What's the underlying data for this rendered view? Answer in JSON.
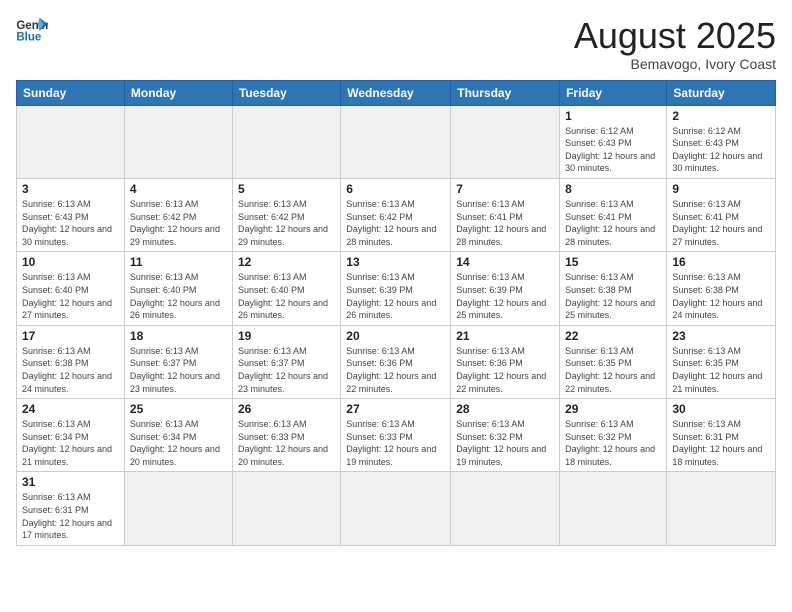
{
  "header": {
    "logo_general": "General",
    "logo_blue": "Blue",
    "month_title": "August 2025",
    "location": "Bemavogo, Ivory Coast"
  },
  "weekdays": [
    "Sunday",
    "Monday",
    "Tuesday",
    "Wednesday",
    "Thursday",
    "Friday",
    "Saturday"
  ],
  "weeks": [
    [
      {
        "day": "",
        "info": ""
      },
      {
        "day": "",
        "info": ""
      },
      {
        "day": "",
        "info": ""
      },
      {
        "day": "",
        "info": ""
      },
      {
        "day": "",
        "info": ""
      },
      {
        "day": "1",
        "info": "Sunrise: 6:12 AM\nSunset: 6:43 PM\nDaylight: 12 hours and 30 minutes."
      },
      {
        "day": "2",
        "info": "Sunrise: 6:12 AM\nSunset: 6:43 PM\nDaylight: 12 hours and 30 minutes."
      }
    ],
    [
      {
        "day": "3",
        "info": "Sunrise: 6:13 AM\nSunset: 6:43 PM\nDaylight: 12 hours and 30 minutes."
      },
      {
        "day": "4",
        "info": "Sunrise: 6:13 AM\nSunset: 6:42 PM\nDaylight: 12 hours and 29 minutes."
      },
      {
        "day": "5",
        "info": "Sunrise: 6:13 AM\nSunset: 6:42 PM\nDaylight: 12 hours and 29 minutes."
      },
      {
        "day": "6",
        "info": "Sunrise: 6:13 AM\nSunset: 6:42 PM\nDaylight: 12 hours and 28 minutes."
      },
      {
        "day": "7",
        "info": "Sunrise: 6:13 AM\nSunset: 6:41 PM\nDaylight: 12 hours and 28 minutes."
      },
      {
        "day": "8",
        "info": "Sunrise: 6:13 AM\nSunset: 6:41 PM\nDaylight: 12 hours and 28 minutes."
      },
      {
        "day": "9",
        "info": "Sunrise: 6:13 AM\nSunset: 6:41 PM\nDaylight: 12 hours and 27 minutes."
      }
    ],
    [
      {
        "day": "10",
        "info": "Sunrise: 6:13 AM\nSunset: 6:40 PM\nDaylight: 12 hours and 27 minutes."
      },
      {
        "day": "11",
        "info": "Sunrise: 6:13 AM\nSunset: 6:40 PM\nDaylight: 12 hours and 26 minutes."
      },
      {
        "day": "12",
        "info": "Sunrise: 6:13 AM\nSunset: 6:40 PM\nDaylight: 12 hours and 26 minutes."
      },
      {
        "day": "13",
        "info": "Sunrise: 6:13 AM\nSunset: 6:39 PM\nDaylight: 12 hours and 26 minutes."
      },
      {
        "day": "14",
        "info": "Sunrise: 6:13 AM\nSunset: 6:39 PM\nDaylight: 12 hours and 25 minutes."
      },
      {
        "day": "15",
        "info": "Sunrise: 6:13 AM\nSunset: 6:38 PM\nDaylight: 12 hours and 25 minutes."
      },
      {
        "day": "16",
        "info": "Sunrise: 6:13 AM\nSunset: 6:38 PM\nDaylight: 12 hours and 24 minutes."
      }
    ],
    [
      {
        "day": "17",
        "info": "Sunrise: 6:13 AM\nSunset: 6:38 PM\nDaylight: 12 hours and 24 minutes."
      },
      {
        "day": "18",
        "info": "Sunrise: 6:13 AM\nSunset: 6:37 PM\nDaylight: 12 hours and 23 minutes."
      },
      {
        "day": "19",
        "info": "Sunrise: 6:13 AM\nSunset: 6:37 PM\nDaylight: 12 hours and 23 minutes."
      },
      {
        "day": "20",
        "info": "Sunrise: 6:13 AM\nSunset: 6:36 PM\nDaylight: 12 hours and 22 minutes."
      },
      {
        "day": "21",
        "info": "Sunrise: 6:13 AM\nSunset: 6:36 PM\nDaylight: 12 hours and 22 minutes."
      },
      {
        "day": "22",
        "info": "Sunrise: 6:13 AM\nSunset: 6:35 PM\nDaylight: 12 hours and 22 minutes."
      },
      {
        "day": "23",
        "info": "Sunrise: 6:13 AM\nSunset: 6:35 PM\nDaylight: 12 hours and 21 minutes."
      }
    ],
    [
      {
        "day": "24",
        "info": "Sunrise: 6:13 AM\nSunset: 6:34 PM\nDaylight: 12 hours and 21 minutes."
      },
      {
        "day": "25",
        "info": "Sunrise: 6:13 AM\nSunset: 6:34 PM\nDaylight: 12 hours and 20 minutes."
      },
      {
        "day": "26",
        "info": "Sunrise: 6:13 AM\nSunset: 6:33 PM\nDaylight: 12 hours and 20 minutes."
      },
      {
        "day": "27",
        "info": "Sunrise: 6:13 AM\nSunset: 6:33 PM\nDaylight: 12 hours and 19 minutes."
      },
      {
        "day": "28",
        "info": "Sunrise: 6:13 AM\nSunset: 6:32 PM\nDaylight: 12 hours and 19 minutes."
      },
      {
        "day": "29",
        "info": "Sunrise: 6:13 AM\nSunset: 6:32 PM\nDaylight: 12 hours and 18 minutes."
      },
      {
        "day": "30",
        "info": "Sunrise: 6:13 AM\nSunset: 6:31 PM\nDaylight: 12 hours and 18 minutes."
      }
    ],
    [
      {
        "day": "31",
        "info": "Sunrise: 6:13 AM\nSunset: 6:31 PM\nDaylight: 12 hours and 17 minutes."
      },
      {
        "day": "",
        "info": ""
      },
      {
        "day": "",
        "info": ""
      },
      {
        "day": "",
        "info": ""
      },
      {
        "day": "",
        "info": ""
      },
      {
        "day": "",
        "info": ""
      },
      {
        "day": "",
        "info": ""
      }
    ]
  ]
}
